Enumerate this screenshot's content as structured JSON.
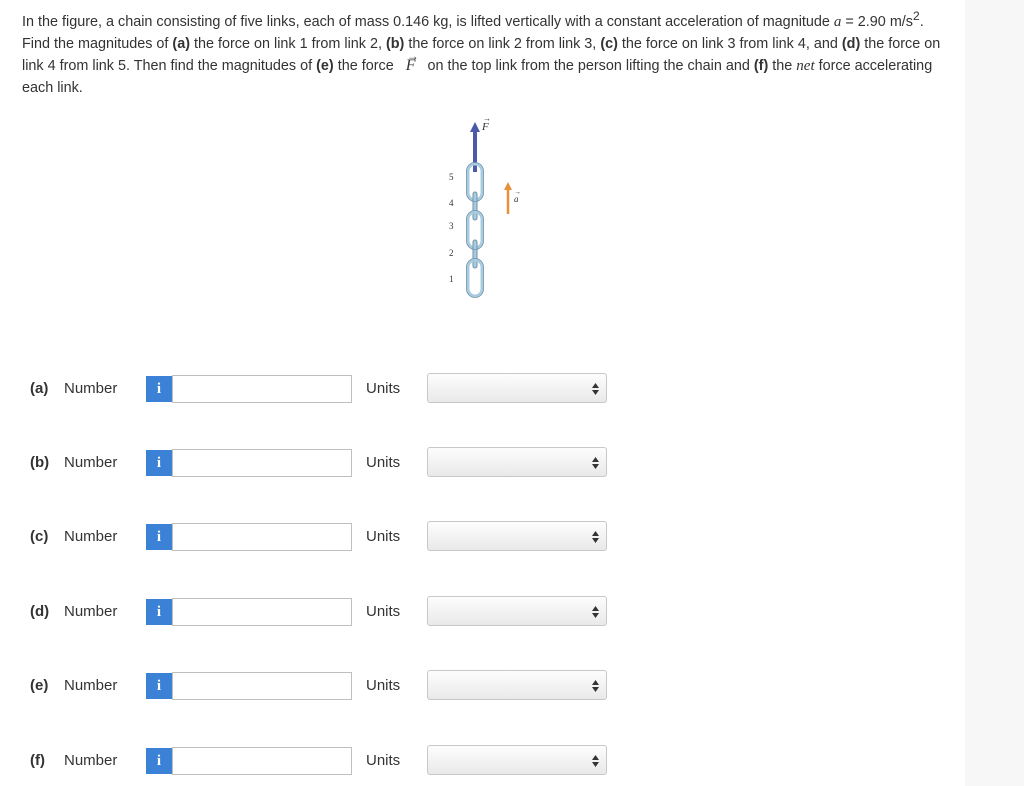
{
  "problem": {
    "seg1": "In the figure, a chain consisting of five links, each of mass 0.146 kg, is lifted vertically with a constant acceleration of magnitude ",
    "a_var": "a",
    "seg2": " = 2.90 m/s",
    "sup": "2",
    "seg3": ". Find the magnitudes of ",
    "pa": "(a)",
    "ta": " the force on link 1 from link 2, ",
    "pb": "(b)",
    "tb": " the force on link 2 from link 3, ",
    "pc": "(c)",
    "tc": " the force on link 3 from link 4, and ",
    "pd": "(d)",
    "td": " the force on link 4 from link 5. Then find the magnitudes of ",
    "pe": "(e)",
    "te1": " the force ",
    "f_var": "F",
    "arrow": "→",
    "te2": " on the top link from the person lifting the chain and ",
    "pf": "(f)",
    "tf1": " the ",
    "net": "net",
    "tf2": " force accelerating each link."
  },
  "figure": {
    "force_label": "F",
    "accel_label": "a",
    "link_numbers": [
      "5",
      "4",
      "3",
      "2",
      "1"
    ],
    "chain_color": "#a9cbe0",
    "force_arrow_color": "#4a5aa8",
    "accel_arrow_color": "#e8913a"
  },
  "rows": [
    {
      "part": "(a)",
      "number_label": "Number",
      "info_icon": "i",
      "value": "",
      "units_label": "Units",
      "units_value": ""
    },
    {
      "part": "(b)",
      "number_label": "Number",
      "info_icon": "i",
      "value": "",
      "units_label": "Units",
      "units_value": ""
    },
    {
      "part": "(c)",
      "number_label": "Number",
      "info_icon": "i",
      "value": "",
      "units_label": "Units",
      "units_value": ""
    },
    {
      "part": "(d)",
      "number_label": "Number",
      "info_icon": "i",
      "value": "",
      "units_label": "Units",
      "units_value": ""
    },
    {
      "part": "(e)",
      "number_label": "Number",
      "info_icon": "i",
      "value": "",
      "units_label": "Units",
      "units_value": ""
    },
    {
      "part": "(f)",
      "number_label": "Number",
      "info_icon": "i",
      "value": "",
      "units_label": "Units",
      "units_value": ""
    }
  ],
  "colors": {
    "info_button": "#3b82d6"
  }
}
